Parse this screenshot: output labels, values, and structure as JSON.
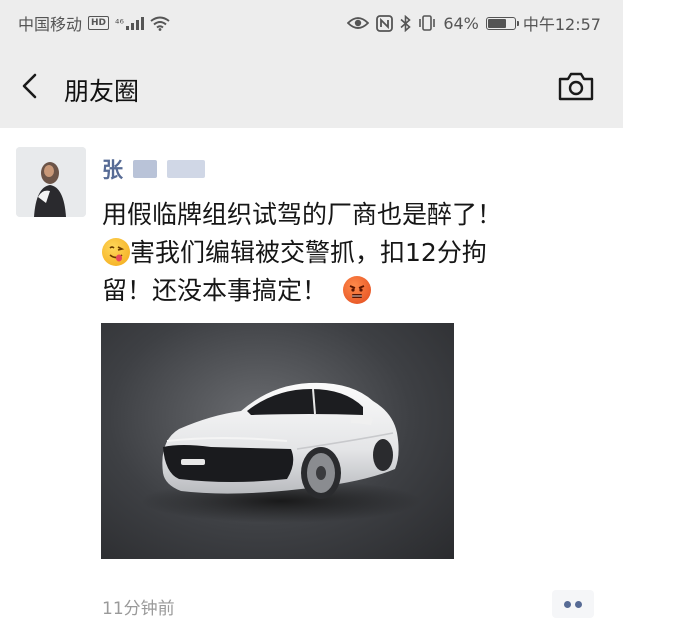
{
  "status_bar": {
    "carrier": "中国移动",
    "hd_badge": "HD",
    "signal_text": "⁴⁶",
    "battery_percent": "64%",
    "battery_level": 0.64,
    "time": "中午12:57"
  },
  "nav": {
    "title": "朋友圈",
    "back_icon": "chevron-left-icon",
    "camera_icon": "camera-icon"
  },
  "post": {
    "username": "张",
    "text_line1": "用假临牌组织试驾的厂商也是醉了！",
    "text_line2": "害我们编辑被交警抓，扣12分拘",
    "text_line3": "留！还没本事搞定！",
    "emoji_1": "tongue-out-emoji",
    "emoji_2": "angry-emoji",
    "image": "white-electric-sedan-photo",
    "timestamp": "11分钟前",
    "more_icon": "more-dots-icon"
  }
}
